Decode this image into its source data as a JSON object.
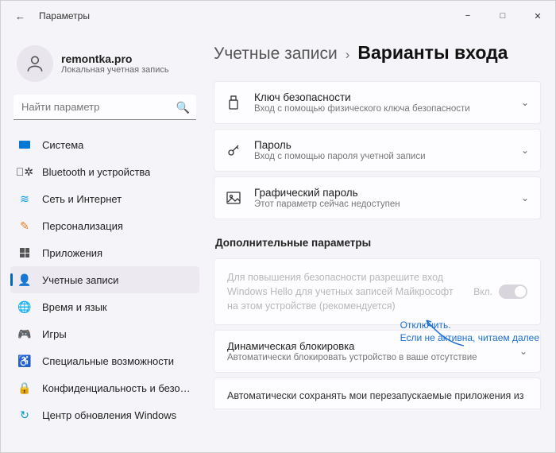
{
  "window": {
    "title": "Параметры"
  },
  "user": {
    "name": "remontka.pro",
    "subtitle": "Локальная учетная запись"
  },
  "search": {
    "placeholder": "Найти параметр"
  },
  "nav": [
    {
      "label": "Система",
      "icon": "system"
    },
    {
      "label": "Bluetooth и устройства",
      "icon": "bluetooth"
    },
    {
      "label": "Сеть и Интернет",
      "icon": "wifi"
    },
    {
      "label": "Персонализация",
      "icon": "personalization"
    },
    {
      "label": "Приложения",
      "icon": "apps"
    },
    {
      "label": "Учетные записи",
      "icon": "accounts",
      "active": true
    },
    {
      "label": "Время и язык",
      "icon": "time"
    },
    {
      "label": "Игры",
      "icon": "games"
    },
    {
      "label": "Специальные возможности",
      "icon": "accessibility"
    },
    {
      "label": "Конфиденциальность и безопасность",
      "icon": "privacy"
    },
    {
      "label": "Центр обновления Windows",
      "icon": "update"
    }
  ],
  "breadcrumb": {
    "parent": "Учетные записи",
    "current": "Варианты входа"
  },
  "cards": [
    {
      "title": "Ключ безопасности",
      "subtitle": "Вход с помощью физического ключа безопасности",
      "icon": "usb-key"
    },
    {
      "title": "Пароль",
      "subtitle": "Вход с помощью пароля учетной записи",
      "icon": "key"
    },
    {
      "title": "Графический пароль",
      "subtitle": "Этот параметр сейчас недоступен",
      "icon": "picture"
    }
  ],
  "additional": {
    "section_title": "Дополнительные параметры",
    "hello": {
      "text": "Для повышения безопасности разрешите вход Windows Hello для учетных записей Майкрософт на этом устройстве (рекомендуется)",
      "toggle_label": "Вкл.",
      "toggle_state": "on_disabled"
    },
    "dynamic_lock": {
      "title": "Динамическая блокировка",
      "subtitle": "Автоматически блокировать устройство в ваше отсутствие"
    },
    "auto_restart": {
      "text": "Автоматически сохранять мои перезапускаемые приложения из"
    }
  },
  "annotation": {
    "line1": "Отключить.",
    "line2": "Если не активна, читаем далее"
  }
}
